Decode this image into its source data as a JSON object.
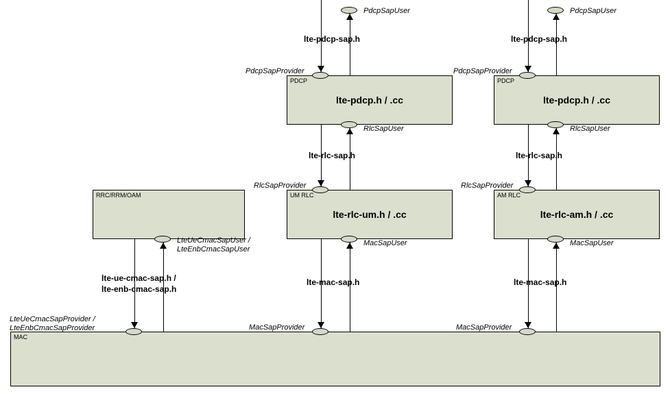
{
  "ports": {
    "pdcpSapUser": "PdcpSapUser",
    "pdcpSapProvider": "PdcpSapProvider",
    "rlcSapUser": "RlcSapUser",
    "rlcSapProvider": "RlcSapProvider",
    "macSapUser": "MacSapUser",
    "macSapProvider": "MacSapProvider",
    "lteUeCmacSapUser": "LteUeCmacSapUser / LteEnbCmacSapUser",
    "lteUeCmacSapProvider": "LteUeCmacSapProvider / LteEnbCmacSapProvider"
  },
  "saps": {
    "ltePdcpSap": "lte-pdcp-sap.h",
    "lteRlcSap": "lte-rlc-sap.h",
    "lteMacSap": "lte-mac-sap.h",
    "lteCmacSap": "lte-ue-cmac-sap.h / lte-enb-cmac-sap.h"
  },
  "boxes": {
    "rrc": {
      "type": "RRC/RRM/OAM",
      "title": ""
    },
    "pdcpLeft": {
      "type": "PDCP",
      "title": "lte-pdcp.h / .cc"
    },
    "pdcpRight": {
      "type": "PDCP",
      "title": "lte-pdcp.h / .cc"
    },
    "umRlc": {
      "type": "UM RLC",
      "title": "lte-rlc-um.h / .cc"
    },
    "amRlc": {
      "type": "AM RLC",
      "title": "lte-rlc-am.h / .cc"
    },
    "mac": {
      "type": "MAC",
      "title": ""
    }
  }
}
